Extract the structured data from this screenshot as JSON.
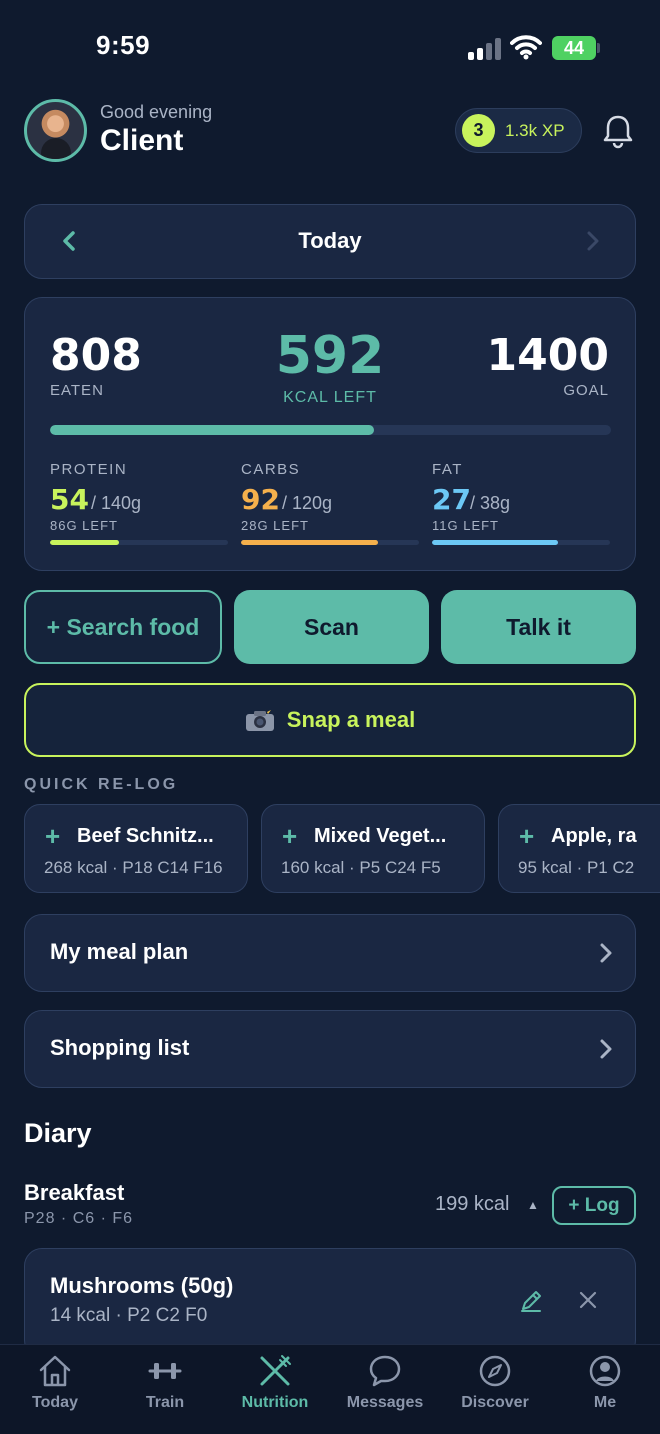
{
  "status_bar": {
    "time": "9:59",
    "battery": "44"
  },
  "header": {
    "greeting": "Good evening",
    "name": "Client",
    "xp_level": "3",
    "xp": "1.3k XP"
  },
  "day_nav": {
    "label": "Today"
  },
  "summary": {
    "eaten": "808",
    "eaten_label": "EATEN",
    "kcal_left": "592",
    "kcal_left_label": "KCAL LEFT",
    "goal": "1400",
    "goal_label": "GOAL",
    "kcal_progress": 0.577
  },
  "macros": [
    {
      "name": "PROTEIN",
      "value": "54",
      "goal": "/ 140g",
      "left": "86G LEFT",
      "color": "#c8f35c",
      "progress": 0.39
    },
    {
      "name": "CARBS",
      "value": "92",
      "goal": "/ 120g",
      "left": "28G LEFT",
      "color": "#f5b04c",
      "progress": 0.77
    },
    {
      "name": "FAT",
      "value": "27",
      "goal": "/ 38g",
      "left": "11G LEFT",
      "color": "#6cc8f5",
      "progress": 0.71
    }
  ],
  "actions": {
    "search": "+ Search food",
    "scan": "Scan",
    "talk": "Talk it",
    "snap": "Snap a meal"
  },
  "quick_relog": {
    "title": "QUICK RE-LOG",
    "items": [
      {
        "name": "Beef Schnitz...",
        "sub": "268 kcal · P18 C14 F16"
      },
      {
        "name": "Mixed Veget...",
        "sub": "160 kcal · P5 C24 F5"
      },
      {
        "name": "Apple, ra",
        "sub": "95 kcal · P1 C2"
      }
    ]
  },
  "links": {
    "meal_plan": "My meal plan",
    "shopping_list": "Shopping list"
  },
  "diary": {
    "title": "Diary",
    "meal": {
      "name": "Breakfast",
      "macros": "P28 · C6 · F6",
      "kcal": "199 kcal",
      "log": "+ Log",
      "entry": {
        "name": "Mushrooms (50g)",
        "sub": "14 kcal · P2 C2 F0"
      }
    }
  },
  "tabs": [
    {
      "label": "Today",
      "icon": "house-icon"
    },
    {
      "label": "Train",
      "icon": "dumbbell-icon"
    },
    {
      "label": "Nutrition",
      "icon": "fork-knife-icon",
      "active": true
    },
    {
      "label": "Messages",
      "icon": "chat-bubble-icon"
    },
    {
      "label": "Discover",
      "icon": "compass-icon"
    },
    {
      "label": "Me",
      "icon": "profile-icon"
    }
  ],
  "colors": {
    "background": "#0f1a2e",
    "accent": "#5dbba8",
    "lime": "#c8f35c",
    "card": "#1a2742"
  }
}
